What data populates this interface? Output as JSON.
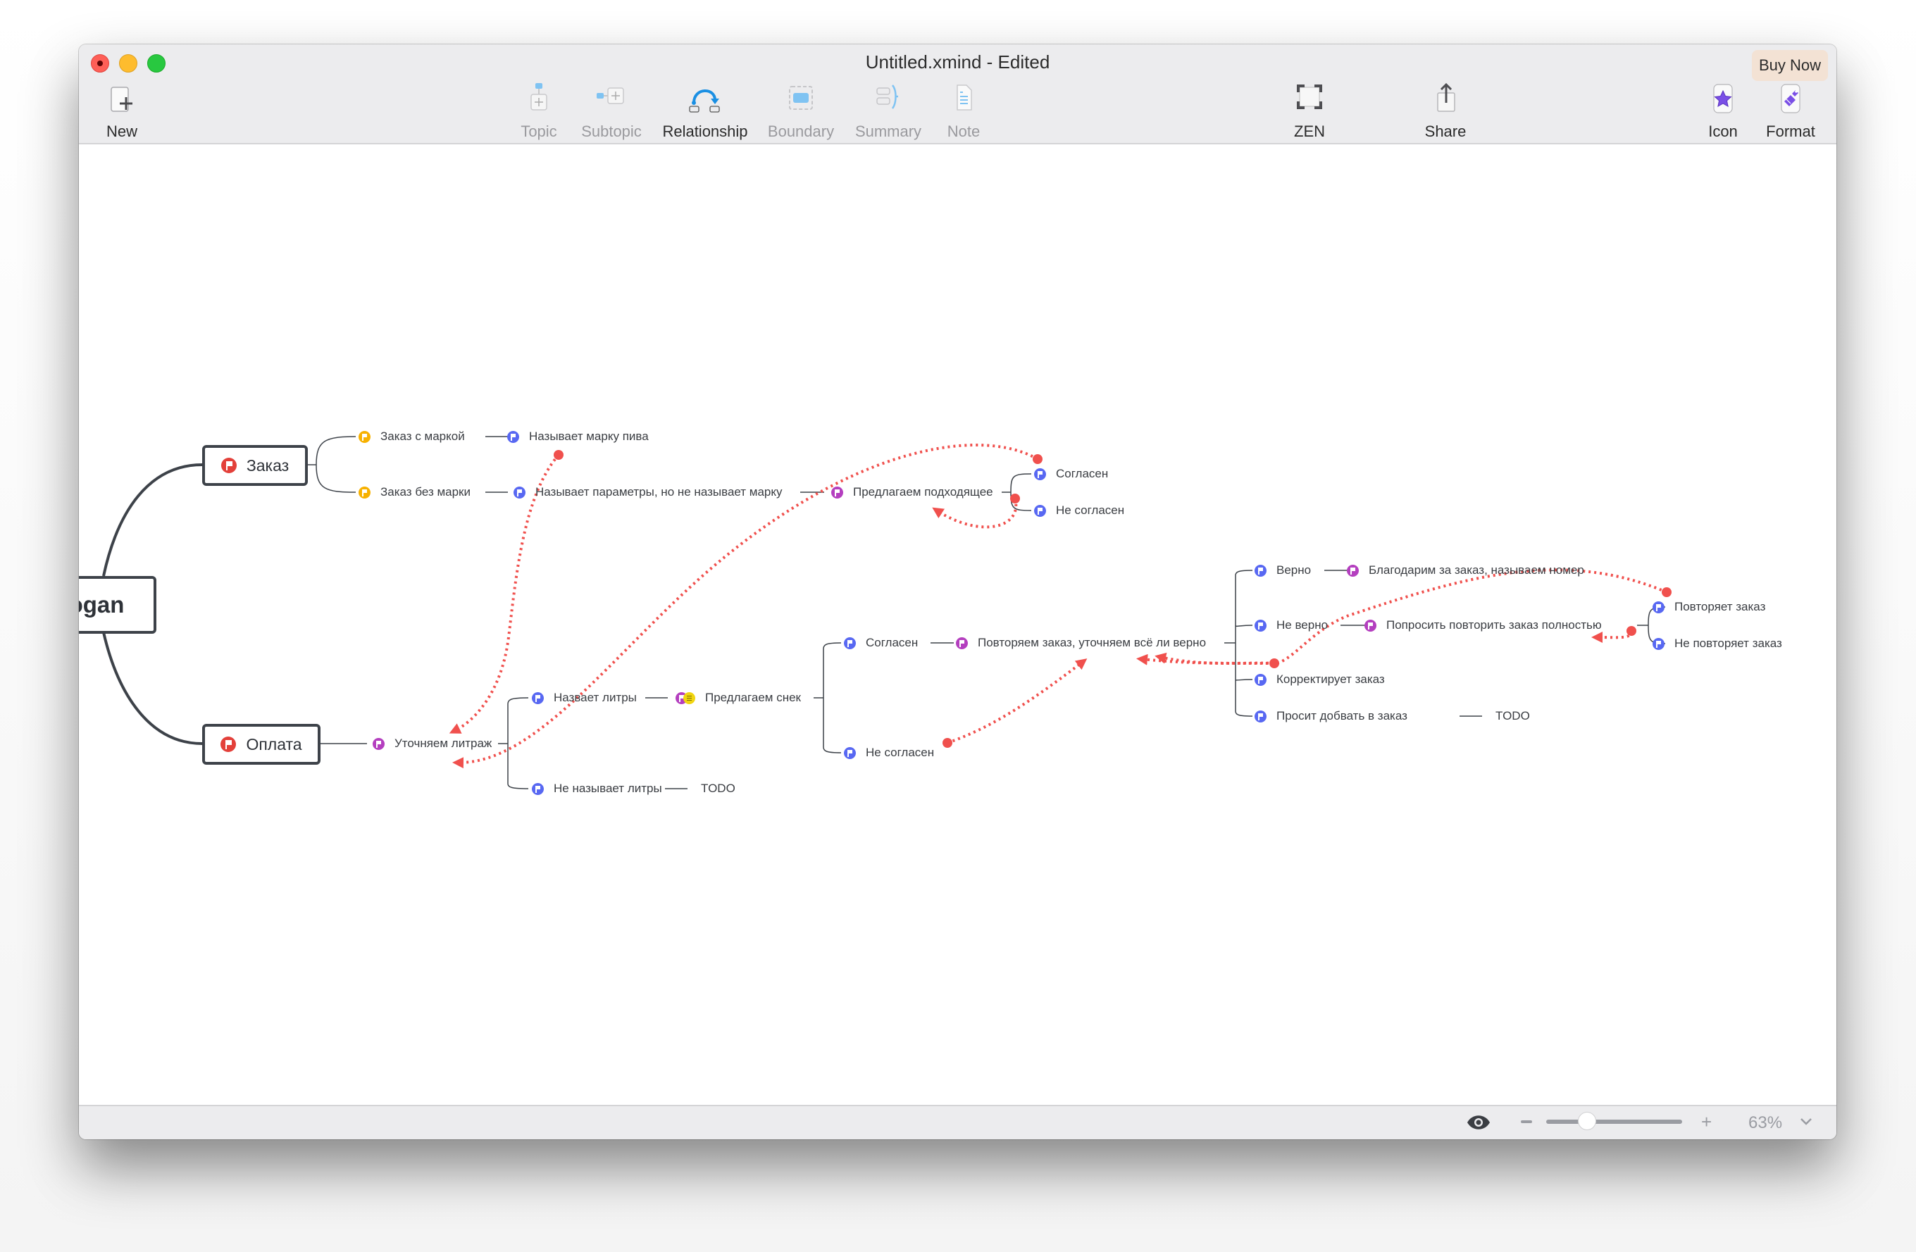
{
  "window": {
    "title": "Untitled.xmind - Edited",
    "buy_now_label": "Buy Now"
  },
  "toolbar": {
    "new": {
      "label": "New",
      "icon": "new-document-icon",
      "enabled": true
    },
    "topic": {
      "label": "Topic",
      "icon": "topic-icon",
      "enabled": false
    },
    "subtopic": {
      "label": "Subtopic",
      "icon": "subtopic-icon",
      "enabled": false
    },
    "relationship": {
      "label": "Relationship",
      "icon": "relationship-icon",
      "enabled": true
    },
    "boundary": {
      "label": "Boundary",
      "icon": "boundary-icon",
      "enabled": false
    },
    "summary": {
      "label": "Summary",
      "icon": "summary-icon",
      "enabled": false
    },
    "note": {
      "label": "Note",
      "icon": "note-icon",
      "enabled": false
    },
    "zen": {
      "label": "ZEN",
      "icon": "zen-icon",
      "enabled": true
    },
    "share": {
      "label": "Share",
      "icon": "share-icon",
      "enabled": true
    },
    "icon": {
      "label": "Icon",
      "icon": "star-icon",
      "enabled": true
    },
    "format": {
      "label": "Format",
      "icon": "paintbrush-icon",
      "enabled": true
    }
  },
  "mindmap": {
    "central_topic": "ogan",
    "branches": {
      "order": {
        "label": "Заказ",
        "flag": "red"
      },
      "payment": {
        "label": "Оплата",
        "flag": "red"
      }
    },
    "nodes": {
      "order_with_brand": {
        "label": "Заказ с маркой",
        "flag": "orange"
      },
      "order_without_brand": {
        "label": "Заказ без марки",
        "flag": "orange"
      },
      "names_beer_brand": {
        "label": "Называет марку пива",
        "flag": "blue"
      },
      "names_params_no_brand": {
        "label": "Называет параметры, но не называет марку",
        "flag": "blue"
      },
      "offer_suitable": {
        "label": "Предлагаем подходящее",
        "flag": "purple"
      },
      "agree_1": {
        "label": "Согласен",
        "flag": "blue"
      },
      "disagree_1": {
        "label": "Не согласен",
        "flag": "blue"
      },
      "clarify_volume": {
        "label": "Уточняем литраж",
        "flag": "purple"
      },
      "names_liters": {
        "label": "Назвает литры",
        "flag": "blue"
      },
      "offer_snack": {
        "label": "Предлагаем снек",
        "flag": "purple",
        "has_note": true
      },
      "no_liters": {
        "label": "Не называет литры",
        "flag": "blue"
      },
      "no_liters_todo": {
        "label": "TODO"
      },
      "agree_2": {
        "label": "Согласен",
        "flag": "blue"
      },
      "repeat_order_check": {
        "label": "Повторяем заказ, уточняем всё ли верно",
        "flag": "purple"
      },
      "disagree_2": {
        "label": "Не согласен",
        "flag": "blue"
      },
      "correct": {
        "label": "Верно",
        "flag": "blue"
      },
      "thanks": {
        "label": "Благодарим за заказ, называем номер",
        "flag": "purple"
      },
      "incorrect": {
        "label": "Не верно",
        "flag": "blue"
      },
      "ask_repeat": {
        "label": "Попросить повторить заказ полностью",
        "flag": "purple"
      },
      "corrects_order": {
        "label": "Корректирует заказ",
        "flag": "blue"
      },
      "asks_add": {
        "label": "Просит добвать в заказ",
        "flag": "blue"
      },
      "asks_add_todo": {
        "label": "TODO"
      },
      "repeats_order": {
        "label": "Повторяет заказ",
        "flag": "blue"
      },
      "not_repeats_order": {
        "label": "Не повторяет заказ",
        "flag": "blue"
      }
    },
    "colors": {
      "relationship": "#f0504d",
      "branch_line": "#3d4249",
      "flag_blue": "#5868f2",
      "flag_purple": "#b43fbf",
      "flag_orange": "#f7b100",
      "flag_red": "#e3403a"
    }
  },
  "statusbar": {
    "zoom_percent": "63%",
    "zoom_level_fraction": 0.3,
    "outline_icon": "eye-icon",
    "zoom_out_label": "−",
    "zoom_in_label": "+"
  }
}
